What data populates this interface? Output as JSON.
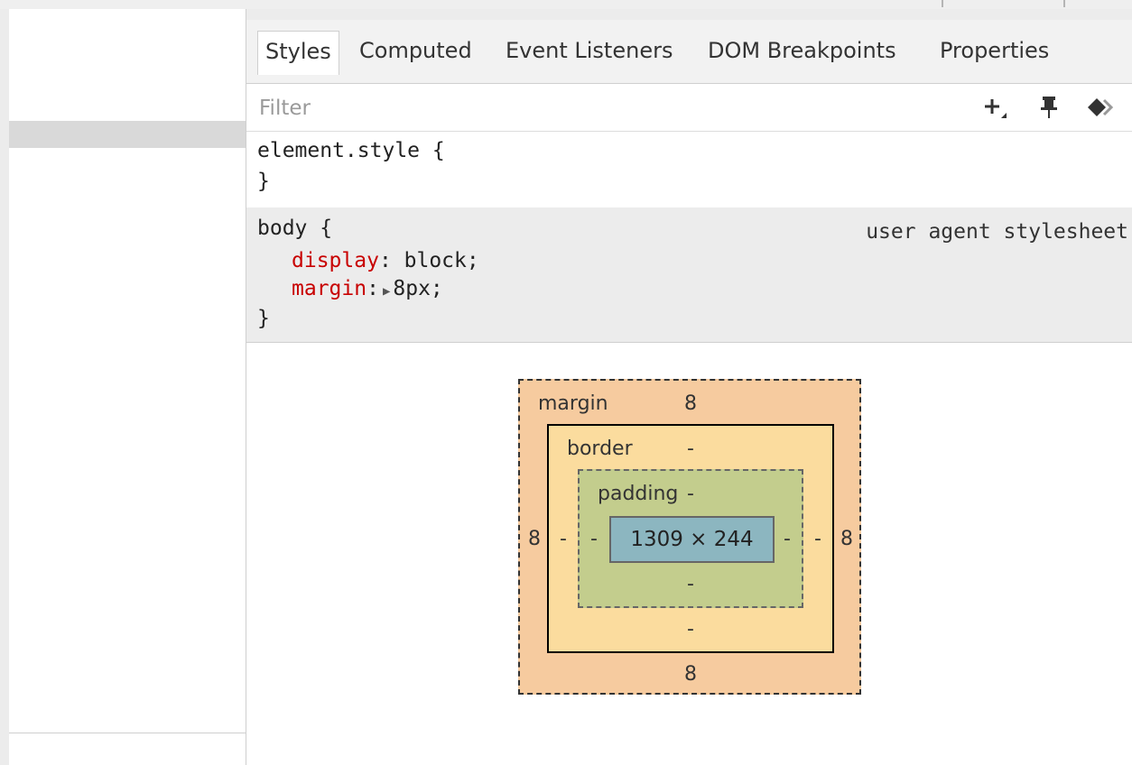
{
  "tabs": [
    "Styles",
    "Computed",
    "Event Listeners",
    "DOM Breakpoints",
    "Properties"
  ],
  "filter": {
    "placeholder": "Filter"
  },
  "toolbar_icons": [
    "new-style-rule-icon",
    "pin-icon",
    "element-state-icon"
  ],
  "element_style_rule": {
    "selector_open": "element.style {",
    "close": "}"
  },
  "body_rule": {
    "selector_open": "body {",
    "source": "user agent stylesheet",
    "properties": [
      {
        "name": "display",
        "value": " block;"
      },
      {
        "name": "margin",
        "value": "8px;"
      }
    ],
    "close": "}"
  },
  "box_model": {
    "margin_label": "margin",
    "border_label": "border",
    "padding_label": "padding",
    "margin": {
      "top": "8",
      "right": "8",
      "bottom": "8",
      "left": "8"
    },
    "border": {
      "top": "-",
      "right": "-",
      "bottom": "-",
      "left": "-"
    },
    "padding": {
      "top": "-",
      "right": "-",
      "bottom": "-",
      "left": "-"
    },
    "content": "1309 × 244"
  },
  "colors": {
    "margin": "#f6cb9f",
    "border": "#fbdc9e",
    "padding": "#c3cd8d",
    "content": "#8cb6c0",
    "property_name": "#c80000"
  }
}
